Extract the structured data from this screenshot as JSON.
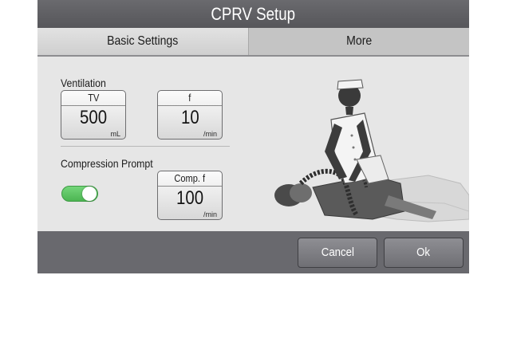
{
  "dialog": {
    "title": "CPRV Setup",
    "tabs": [
      {
        "label": "Basic Settings",
        "active": true
      },
      {
        "label": "More",
        "active": false
      }
    ]
  },
  "ventilation": {
    "label": "Ventilation",
    "tv": {
      "name": "TV",
      "value": "500",
      "unit": "mL"
    },
    "f": {
      "name": "f",
      "value": "10",
      "unit": "/min"
    }
  },
  "compression": {
    "label": "Compression Prompt",
    "toggle_on": true,
    "comp_f": {
      "name": "Comp. f",
      "value": "100",
      "unit": "/min"
    }
  },
  "footer": {
    "cancel_label": "Cancel",
    "ok_label": "Ok"
  },
  "colors": {
    "title_bg": "#5f5f63",
    "panel_bg": "#e6e6e6",
    "toggle_on": "#5cc462",
    "footer_bg": "#69696e"
  },
  "icons": {
    "illustration": "cpr-nurse-patient-illustration"
  }
}
